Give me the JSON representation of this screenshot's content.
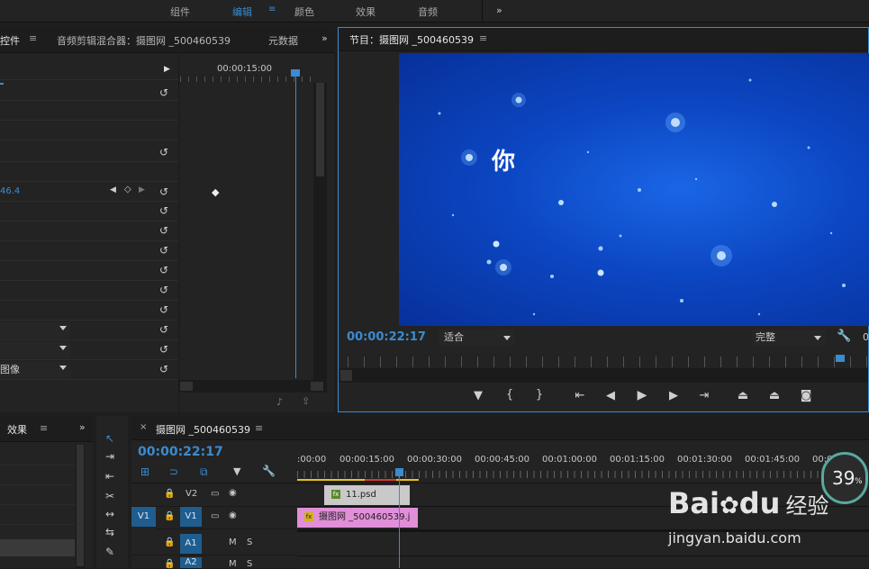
{
  "workspaces": {
    "items": [
      "组件",
      "编辑",
      "颜色",
      "效果",
      "音频"
    ],
    "active_index": 1,
    "overflow": "»"
  },
  "effect_controls": {
    "tab_label": "控件",
    "tab2_label": "音频剪辑混合器：摄图网 _500460539",
    "tab3_label": "元数据",
    "overflow": "»",
    "ruler_time": "00:00:15:00",
    "value_row": "46.4",
    "dropdowns": [
      "",
      "",
      "图像"
    ]
  },
  "program_monitor": {
    "title": "节目：摄图网 _500460539",
    "timecode": "00:00:22:17",
    "fit_select": "适合",
    "quality_select": "完整",
    "overflow_text": "0",
    "overlay_text": "你",
    "sky_color": "#0a3fb8"
  },
  "effects_panel": {
    "tab_label": "效果",
    "overflow": "»"
  },
  "timeline": {
    "sequence_name": "摄图网 _500460539",
    "timecode": "00:00:22:17",
    "ruler_labels": [
      ":00:00",
      "00:00:15:00",
      "00:00:30:00",
      "00:00:45:00",
      "00:01:00:00",
      "00:01:15:00",
      "00:01:30:00",
      "00:01:45:00",
      "00:02:00:"
    ],
    "tracks": [
      {
        "source": "",
        "target": "V2",
        "kind": "video"
      },
      {
        "source": "V1",
        "target": "V1",
        "kind": "video"
      },
      {
        "source": "",
        "target": "A1",
        "kind": "audio"
      },
      {
        "source": "",
        "target": "A2",
        "kind": "audio"
      }
    ],
    "clips": [
      {
        "label": "11.psd",
        "track": "V2",
        "color": "#c9c9c9"
      },
      {
        "label": "摄图网 _500460539.j",
        "track": "V1",
        "color": "#e08fd8"
      }
    ],
    "audio_buttons": {
      "mute": "M",
      "solo": "S"
    }
  },
  "overlay_widget": {
    "percent": "39",
    "unit": "%"
  },
  "watermark": {
    "text": "jingyan.baidu.com"
  }
}
